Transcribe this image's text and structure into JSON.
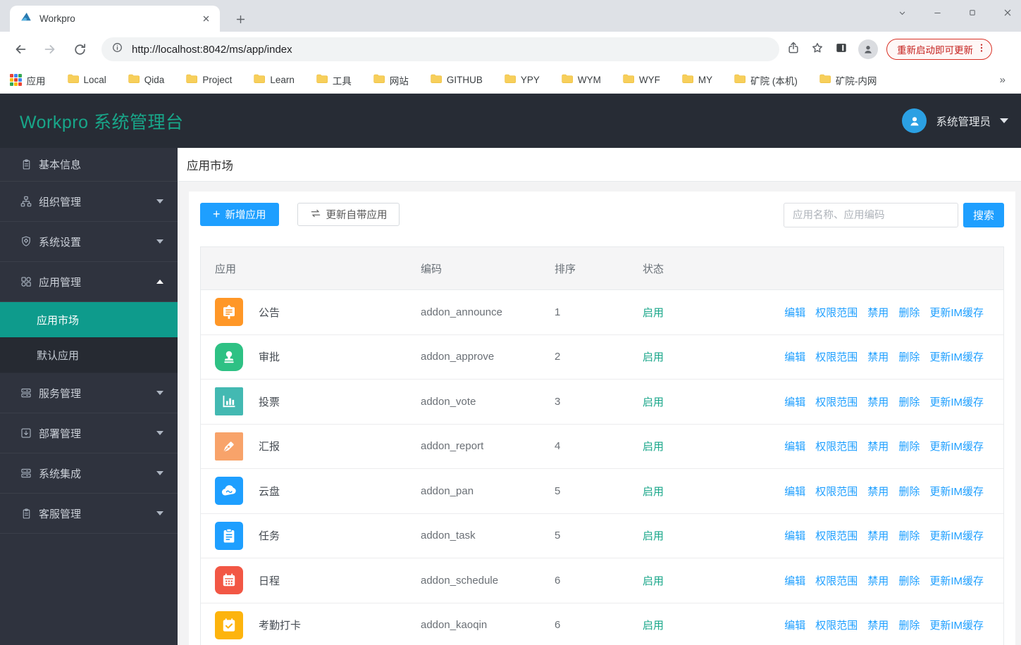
{
  "browser": {
    "tab_title": "Workpro",
    "url": "http://localhost:8042/ms/app/index",
    "update_chip": "重新启动即可更新",
    "bookmarks_overflow": "»",
    "bookmarks": [
      {
        "label": "应用",
        "icon": "apps-grid"
      },
      {
        "label": "Local",
        "icon": "folder"
      },
      {
        "label": "Qida",
        "icon": "folder"
      },
      {
        "label": "Project",
        "icon": "folder"
      },
      {
        "label": "Learn",
        "icon": "folder"
      },
      {
        "label": "工具",
        "icon": "folder"
      },
      {
        "label": "网站",
        "icon": "folder"
      },
      {
        "label": "GITHUB",
        "icon": "folder"
      },
      {
        "label": "YPY",
        "icon": "folder"
      },
      {
        "label": "WYM",
        "icon": "folder"
      },
      {
        "label": "WYF",
        "icon": "folder"
      },
      {
        "label": "MY",
        "icon": "folder"
      },
      {
        "label": "矿院 (本机)",
        "icon": "folder"
      },
      {
        "label": "矿院-内网",
        "icon": "folder"
      }
    ]
  },
  "header": {
    "logo": "Workpro 系统管理台",
    "user": "系统管理员"
  },
  "sidebar": {
    "items": [
      {
        "label": "基本信息",
        "icon": "clipboard",
        "arrow": ""
      },
      {
        "label": "组织管理",
        "icon": "sitemap",
        "arrow": "down"
      },
      {
        "label": "系统设置",
        "icon": "shield",
        "arrow": "down"
      },
      {
        "label": "应用管理",
        "icon": "grid",
        "arrow": "up",
        "children": [
          {
            "label": "应用市场",
            "active": true
          },
          {
            "label": "默认应用",
            "active": false
          }
        ]
      },
      {
        "label": "服务管理",
        "icon": "server",
        "arrow": "down"
      },
      {
        "label": "部署管理",
        "icon": "deploy",
        "arrow": "down"
      },
      {
        "label": "系统集成",
        "icon": "server",
        "arrow": "down"
      },
      {
        "label": "客服管理",
        "icon": "clipboard",
        "arrow": "down"
      }
    ]
  },
  "page": {
    "title": "应用市场"
  },
  "toolbar": {
    "add_button": "新增应用",
    "update_button": "更新自带应用",
    "search_placeholder": "应用名称、应用编码",
    "search_button": "搜索"
  },
  "table": {
    "headers": [
      "应用",
      "编码",
      "排序",
      "状态",
      ""
    ],
    "actions": [
      "编辑",
      "权限范围",
      "禁用",
      "删除",
      "更新IM缓存"
    ],
    "rows": [
      {
        "name": "公告",
        "code": "addon_announce",
        "sort": "1",
        "status": "启用",
        "icon": "announce",
        "color": "#ff9727"
      },
      {
        "name": "审批",
        "code": "addon_approve",
        "sort": "2",
        "status": "启用",
        "icon": "stamp",
        "color": "#2ec184"
      },
      {
        "name": "投票",
        "code": "addon_vote",
        "sort": "3",
        "status": "启用",
        "icon": "chart",
        "color": "#43b9b2"
      },
      {
        "name": "汇报",
        "code": "addon_report",
        "sort": "4",
        "status": "启用",
        "icon": "pen",
        "color": "#f8a36a"
      },
      {
        "name": "云盘",
        "code": "addon_pan",
        "sort": "5",
        "status": "启用",
        "icon": "cloud",
        "color": "#1e9fff"
      },
      {
        "name": "任务",
        "code": "addon_task",
        "sort": "5",
        "status": "启用",
        "icon": "clipboard-task",
        "color": "#1e9fff"
      },
      {
        "name": "日程",
        "code": "addon_schedule",
        "sort": "6",
        "status": "启用",
        "icon": "calendar",
        "color": "#f25745"
      },
      {
        "name": "考勤打卡",
        "code": "addon_kaoqin",
        "sort": "6",
        "status": "启用",
        "icon": "calendar-check",
        "color": "#fdb40d"
      }
    ]
  },
  "colors": {
    "accent_teal": "#18a689",
    "active_menu": "#0e9b8c",
    "link_blue": "#1e9fff",
    "status_enabled": "#18a689",
    "chip_red": "#c5221f"
  }
}
